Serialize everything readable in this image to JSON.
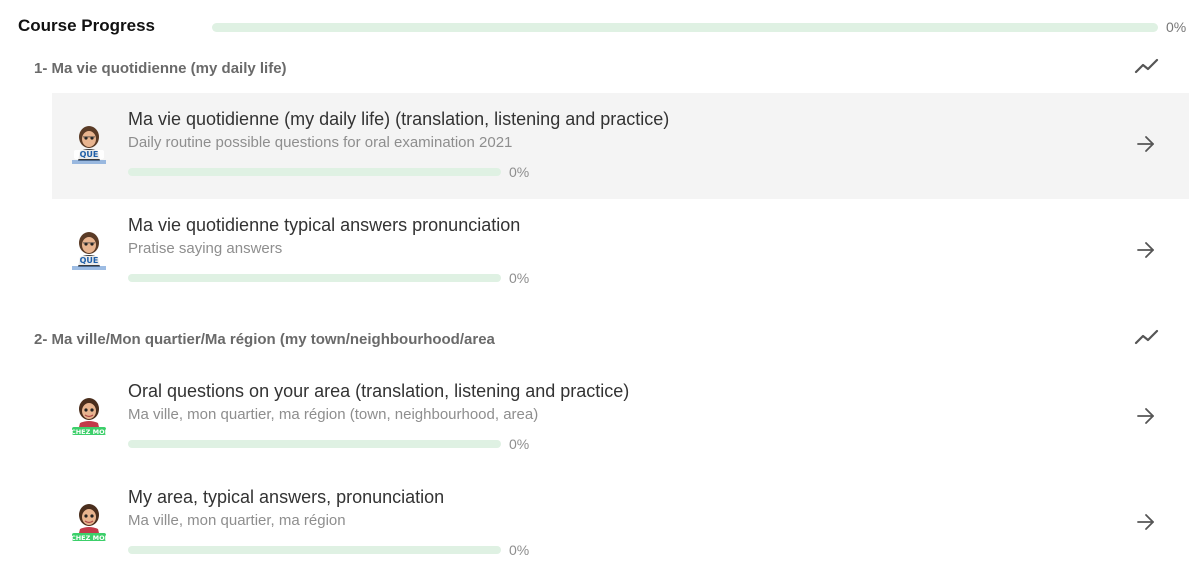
{
  "course": {
    "title": "Course Progress",
    "progress_percent": 0,
    "progress_label": "0%",
    "colors": {
      "track": "#dff1e3",
      "fill": "#5cb874"
    }
  },
  "sections": [
    {
      "title": "1- Ma vie quotidienne (my daily life)",
      "icon": "trend-line-icon",
      "lessons": [
        {
          "title": "Ma vie quotidienne (my daily life) (translation, listening and practice)",
          "subtitle": "Daily routine possible questions for oral examination 2021",
          "progress_percent": 0,
          "progress_label": "0%",
          "avatar": "bitmoji-que-avatar",
          "icon": "arrow-right-icon"
        },
        {
          "title": "Ma vie quotidienne typical answers pronunciation",
          "subtitle": "Pratise saying answers",
          "progress_percent": 0,
          "progress_label": "0%",
          "avatar": "bitmoji-que-avatar",
          "icon": "arrow-right-icon"
        }
      ]
    },
    {
      "title": "2- Ma ville/Mon quartier/Ma région (my town/neighbourhood/area",
      "icon": "trend-line-icon",
      "lessons": [
        {
          "title": "Oral questions on your area (translation, listening and practice)",
          "subtitle": "Ma ville, mon quartier, ma région (town, neighbourhood, area)",
          "progress_percent": 0,
          "progress_label": "0%",
          "avatar": "bitmoji-green-avatar",
          "icon": "arrow-right-icon"
        },
        {
          "title": "My area, typical answers, pronunciation",
          "subtitle": "Ma ville, mon quartier, ma région",
          "progress_percent": 0,
          "progress_label": "0%",
          "avatar": "bitmoji-green-avatar",
          "icon": "arrow-right-icon"
        }
      ]
    }
  ]
}
